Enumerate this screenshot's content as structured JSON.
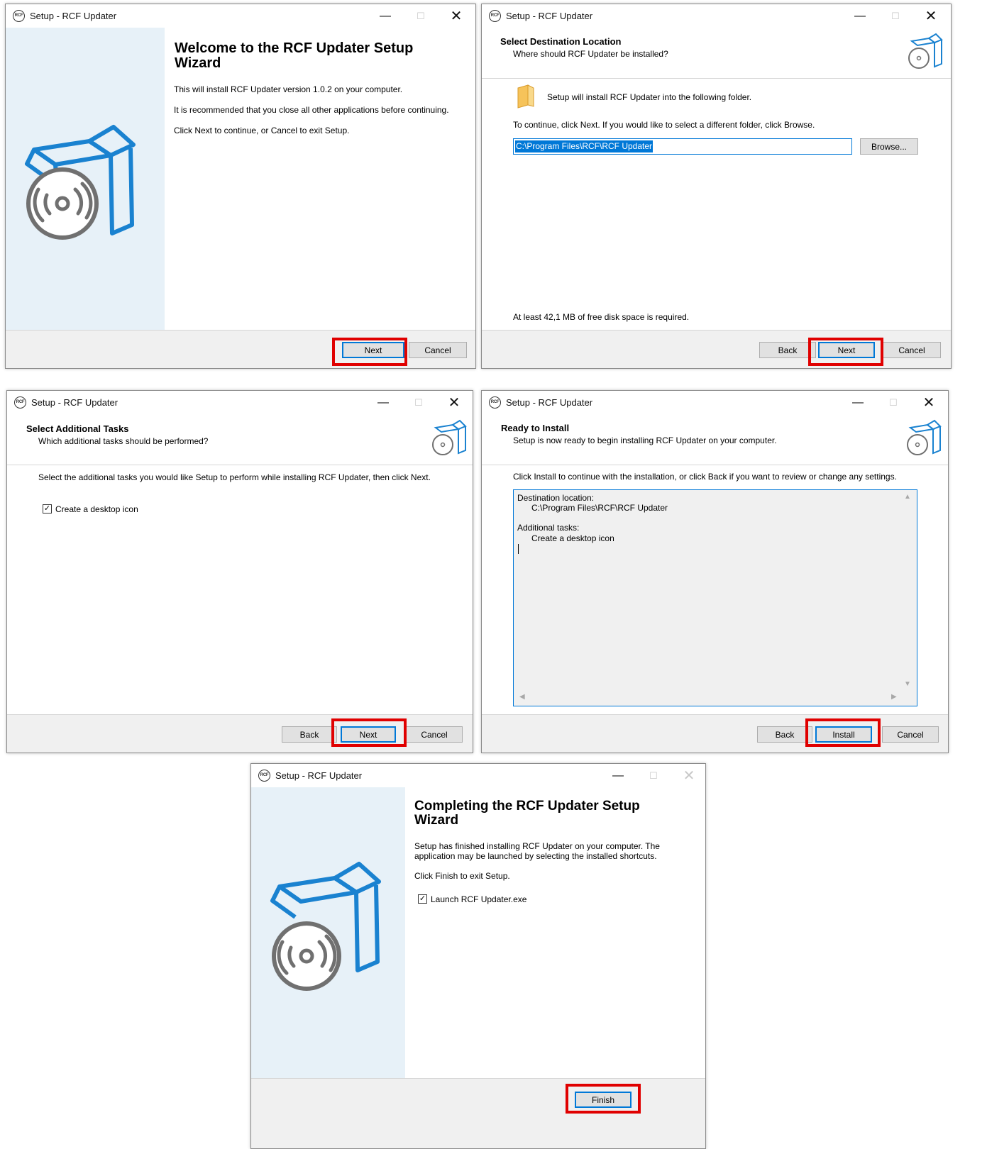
{
  "app": {
    "icon_text": "RCF",
    "window_title": "Setup - RCF Updater",
    "minimize_glyph": "—",
    "maximize_glyph": "☐",
    "close_glyph": "✕"
  },
  "welcome": {
    "heading": "Welcome to the RCF Updater Setup Wizard",
    "line1": "This will install RCF Updater version 1.0.2 on your computer.",
    "line2": "It is recommended that you close all other applications before continuing.",
    "line3": "Click Next to continue, or Cancel to exit Setup.",
    "next_label": "Next",
    "cancel_label": "Cancel"
  },
  "destination": {
    "header_title": "Select Destination Location",
    "header_subtitle": "Where should RCF Updater be installed?",
    "folder_text": "Setup will install RCF Updater into the following folder.",
    "continue_text": "To continue, click Next. If you would like to select a different folder, click Browse.",
    "path_value": "C:\\Program Files\\RCF\\RCF Updater",
    "browse_label": "Browse...",
    "disk_space_text": "At least 42,1 MB of free disk space is required.",
    "back_label": "Back",
    "next_label": "Next",
    "cancel_label": "Cancel"
  },
  "tasks": {
    "header_title": "Select Additional Tasks",
    "header_subtitle": "Which additional tasks should be performed?",
    "instruction": "Select the additional tasks you would like Setup to perform while installing RCF Updater, then click Next.",
    "desktop_icon_label": "Create a desktop icon",
    "desktop_icon_checked": true,
    "check_glyph": "✓",
    "back_label": "Back",
    "next_label": "Next",
    "cancel_label": "Cancel"
  },
  "ready": {
    "header_title": "Ready to Install",
    "header_subtitle": "Setup is now ready to begin installing RCF Updater on your computer.",
    "instruction": "Click Install to continue with the installation, or click Back if you want to review or change any settings.",
    "memo_dest_label": "Destination location:",
    "memo_dest_value": "C:\\Program Files\\RCF\\RCF Updater",
    "memo_tasks_label": "Additional tasks:",
    "memo_tasks_value": "Create a desktop icon",
    "back_label": "Back",
    "install_label": "Install",
    "cancel_label": "Cancel"
  },
  "finish": {
    "heading": "Completing the RCF Updater Setup Wizard",
    "line1a": "Setup has finished installing RCF Updater on your computer. The",
    "line1b": "application may be launched by selecting the installed shortcuts.",
    "line2": "Click Finish to exit Setup.",
    "launch_label": "Launch RCF Updater.exe",
    "launch_checked": true,
    "finish_label": "Finish"
  },
  "colors": {
    "highlight": "#e00000",
    "accent": "#0078d7",
    "sidebar": "#e7f1f8"
  }
}
